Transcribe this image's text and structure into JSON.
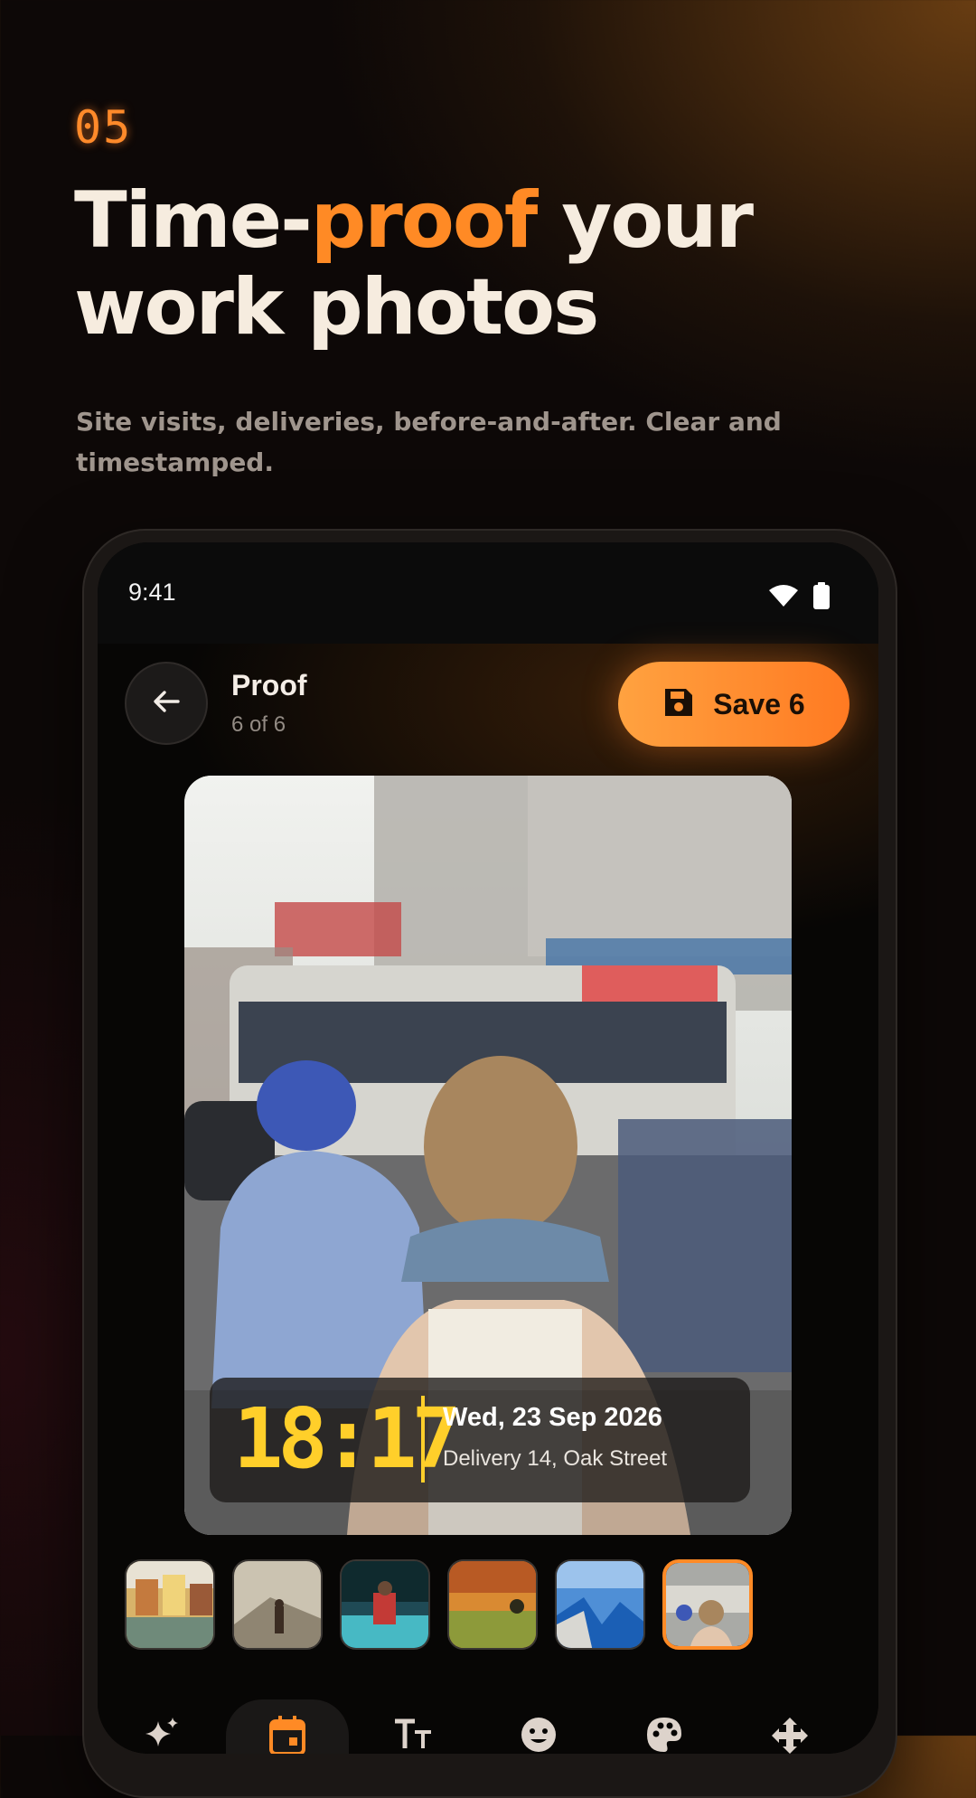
{
  "intro": {
    "step": "05",
    "headline_before": "Time-",
    "headline_accent": "proof",
    "headline_after": " your work photos",
    "subtitle": "Site visits, deliveries, before-and-after. Clear and timestamped."
  },
  "status_bar": {
    "time": "9:41",
    "icons": [
      "wifi-icon",
      "battery-icon"
    ]
  },
  "header": {
    "title": "Proof",
    "counter": "6 of 6",
    "save_label": "Save 6",
    "back_icon": "arrow-left-icon",
    "save_icon": "floppy-disk-icon"
  },
  "stamp": {
    "time": "18:17",
    "date": "Wed, 23 Sep 2026",
    "location": "Delivery 14, Oak Street"
  },
  "thumbnails": {
    "count": 6,
    "selected_index": 5,
    "items": [
      "canal-houses",
      "hiker-in-fog",
      "kayak-on-lake",
      "sunset-meadow",
      "fjord-view",
      "street-scene"
    ]
  },
  "toolbar": {
    "tabs": [
      "sparkles-icon",
      "calendar-icon",
      "text-size-icon",
      "emoji-icon",
      "palette-icon",
      "move-icon"
    ],
    "active_index": 1
  },
  "colors": {
    "accent": "#ff8a25",
    "stamp_time": "#ffcf2a",
    "background": "#0d0807"
  }
}
